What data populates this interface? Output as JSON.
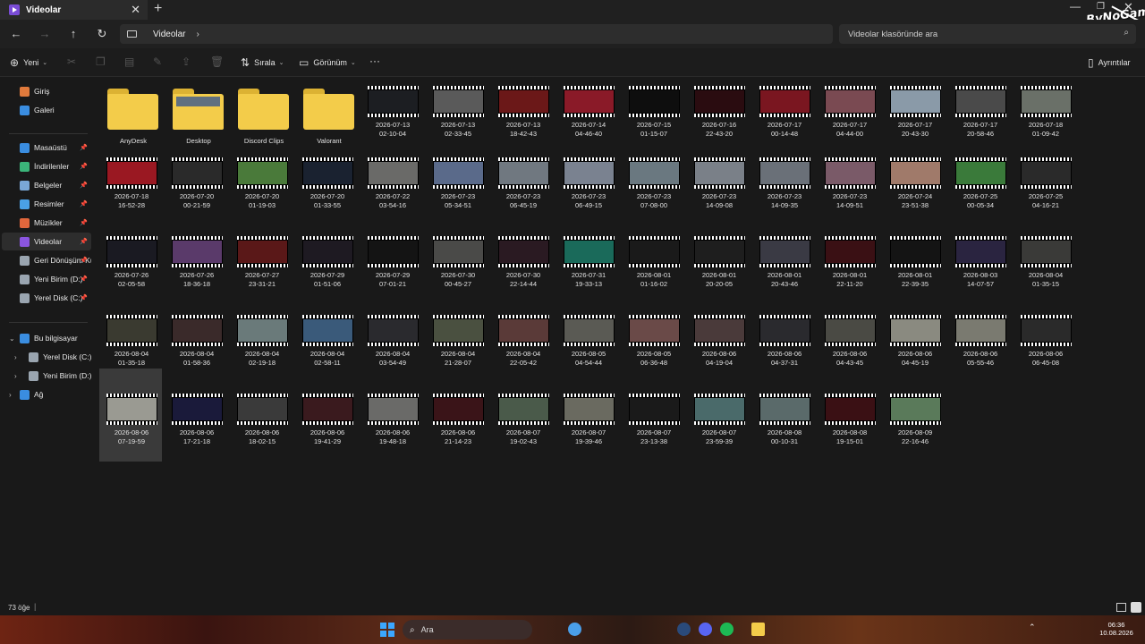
{
  "window": {
    "tab_title": "Videolar",
    "tab_close": "✕",
    "new_tab": "+",
    "brand": "ByNoGame",
    "brand_suffix": ".com"
  },
  "nav": {
    "back": "←",
    "forward": "→",
    "up": "↑",
    "refresh": "↻",
    "location": "Videolar",
    "chevron": "›",
    "search_placeholder": "Videolar klasöründe ara",
    "search_icon": "⌕"
  },
  "commands": {
    "new_label": "Yeni",
    "sort_label": "Sırala",
    "view_label": "Görünüm",
    "more_label": "···",
    "details_label": "Ayrıntılar"
  },
  "sidebar": {
    "items": [
      {
        "label": "Giriş",
        "icon": "home-icon",
        "color": "#e07a3c"
      },
      {
        "label": "Galeri",
        "icon": "gallery-icon",
        "color": "#3a8de0"
      },
      {
        "label": "Masaüstü",
        "icon": "desktop-icon",
        "color": "#3a8de0"
      },
      {
        "label": "İndirilenler",
        "icon": "download-icon",
        "color": "#3bb57a"
      },
      {
        "label": "Belgeler",
        "icon": "documents-icon",
        "color": "#7aa7d6"
      },
      {
        "label": "Resimler",
        "icon": "pictures-icon",
        "color": "#4aa0e6"
      },
      {
        "label": "Müzikler",
        "icon": "music-icon",
        "color": "#e0673c"
      },
      {
        "label": "Videolar",
        "icon": "videos-icon",
        "color": "#8b55e0"
      },
      {
        "label": "Geri Dönüşüm Kutusu",
        "icon": "recycle-bin-icon",
        "color": "#9aa5b0"
      },
      {
        "label": "Yeni Birim (D:)",
        "icon": "drive-icon",
        "color": "#9aa5b0"
      },
      {
        "label": "Yerel Disk (C:)",
        "icon": "drive-icon",
        "color": "#9aa5b0"
      },
      {
        "label": "Bu bilgisayar",
        "icon": "computer-icon",
        "color": "#3a8de0"
      },
      {
        "label": "Yerel Disk (C:)",
        "icon": "drive-icon",
        "color": "#9aa5b0"
      },
      {
        "label": "Yeni Birim (D:)",
        "icon": "drive-icon",
        "color": "#9aa5b0"
      },
      {
        "label": "Ağ",
        "icon": "network-icon",
        "color": "#3a8de0"
      }
    ]
  },
  "folders": [
    {
      "name": "AnyDesk",
      "preview": false
    },
    {
      "name": "Desktop",
      "preview": true
    },
    {
      "name": "Discord Clips",
      "preview": false
    },
    {
      "name": "Valorant",
      "preview": false
    }
  ],
  "videos": [
    {
      "name": "2026-07-13\n02-10-04",
      "thumb": "#1c1e22"
    },
    {
      "name": "2026-07-13\n02-33-45",
      "thumb": "#5a5a5a"
    },
    {
      "name": "2026-07-13\n18-42-43",
      "thumb": "#6b1818"
    },
    {
      "name": "2026-07-14\n04-46-40",
      "thumb": "#8a1a28"
    },
    {
      "name": "2026-07-15\n01-15-07",
      "thumb": "#0e0e0e"
    },
    {
      "name": "2026-07-16\n22-43-20",
      "thumb": "#2a0c10"
    },
    {
      "name": "2026-07-17\n00-14-48",
      "thumb": "#7a1620"
    },
    {
      "name": "2026-07-17\n04-44-00",
      "thumb": "#7a4a52"
    },
    {
      "name": "2026-07-17\n20-43-30",
      "thumb": "#8a9aa8"
    },
    {
      "name": "2026-07-17\n20-58-46",
      "thumb": "#4a4a4a"
    },
    {
      "name": "2026-07-18\n01-09-42",
      "thumb": "#6a7068"
    },
    {
      "name": "2026-07-18\n16-52-28",
      "thumb": "#9a1822"
    },
    {
      "name": "2026-07-20\n00-21-59",
      "thumb": "#2a2a2a"
    },
    {
      "name": "2026-07-20\n01-19-03",
      "thumb": "#4a7a3a"
    },
    {
      "name": "2026-07-20\n01-33-55",
      "thumb": "#1a2230"
    },
    {
      "name": "2026-07-22\n03-54-16",
      "thumb": "#6a6a68"
    },
    {
      "name": "2026-07-23\n05-34-51",
      "thumb": "#5a6a8a"
    },
    {
      "name": "2026-07-23\n06-45-19",
      "thumb": "#707880"
    },
    {
      "name": "2026-07-23\n06-49-15",
      "thumb": "#7a8290"
    },
    {
      "name": "2026-07-23\n07-08-00",
      "thumb": "#6a7880"
    },
    {
      "name": "2026-07-23\n14-09-08",
      "thumb": "#7a8088"
    },
    {
      "name": "2026-07-23\n14-09-35",
      "thumb": "#6a7078"
    },
    {
      "name": "2026-07-23\n14-09-51",
      "thumb": "#7a5a68"
    },
    {
      "name": "2026-07-24\n23-51-38",
      "thumb": "#a07a6a"
    },
    {
      "name": "2026-07-25\n00-05-34",
      "thumb": "#3a7a3a"
    },
    {
      "name": "2026-07-25\n04-16-21",
      "thumb": "#2a2a2a"
    },
    {
      "name": "2026-07-26\n02-05-58",
      "thumb": "#1a1a22"
    },
    {
      "name": "2026-07-26\n18-36-18",
      "thumb": "#5a3a6a"
    },
    {
      "name": "2026-07-27\n23-31-21",
      "thumb": "#5a1818"
    },
    {
      "name": "2026-07-29\n01-51-06",
      "thumb": "#1e1a22"
    },
    {
      "name": "2026-07-29\n07-01-21",
      "thumb": "#141414"
    },
    {
      "name": "2026-07-30\n00-45-27",
      "thumb": "#4a4a48"
    },
    {
      "name": "2026-07-30\n22-14-44",
      "thumb": "#2a1a22"
    },
    {
      "name": "2026-07-31\n19-33-13",
      "thumb": "#1a6a5a"
    },
    {
      "name": "2026-08-01\n01-16-02",
      "thumb": "#1a1a1a"
    },
    {
      "name": "2026-08-01\n20-20-05",
      "thumb": "#1e1e1e"
    },
    {
      "name": "2026-08-01\n20-43-46",
      "thumb": "#3a3a44"
    },
    {
      "name": "2026-08-01\n22-11-20",
      "thumb": "#3a1014"
    },
    {
      "name": "2026-08-01\n22-39-35",
      "thumb": "#141414"
    },
    {
      "name": "2026-08-03\n14-07-57",
      "thumb": "#2a2440"
    },
    {
      "name": "2026-08-04\n01-35-15",
      "thumb": "#3a3a38"
    },
    {
      "name": "2026-08-04\n01-35-18",
      "thumb": "#3a3a30"
    },
    {
      "name": "2026-08-04\n01-58-36",
      "thumb": "#3a2a2a"
    },
    {
      "name": "2026-08-04\n02-19-18",
      "thumb": "#6a7a7a"
    },
    {
      "name": "2026-08-04\n02-58-11",
      "thumb": "#3a5a7a"
    },
    {
      "name": "2026-08-04\n03-54-49",
      "thumb": "#2a2a2e"
    },
    {
      "name": "2026-08-04\n21-28-07",
      "thumb": "#4a5040"
    },
    {
      "name": "2026-08-04\n22-05-42",
      "thumb": "#5a3a38"
    },
    {
      "name": "2026-08-05\n04-54-44",
      "thumb": "#5a5a54"
    },
    {
      "name": "2026-08-05\n06-36-48",
      "thumb": "#6a4a48"
    },
    {
      "name": "2026-08-06\n04-19-04",
      "thumb": "#4a3a3a"
    },
    {
      "name": "2026-08-06\n04-37-31",
      "thumb": "#2a2a2e"
    },
    {
      "name": "2026-08-06\n04-43-45",
      "thumb": "#4a4a44"
    },
    {
      "name": "2026-08-06\n04-45-19",
      "thumb": "#8a8a80"
    },
    {
      "name": "2026-08-06\n05-55-46",
      "thumb": "#7a7a70"
    },
    {
      "name": "2026-08-06\n06-45-08",
      "thumb": "#2a2a2a"
    },
    {
      "name": "2026-08-06\n07-19-59",
      "thumb": "#9a9a92",
      "selected": true
    },
    {
      "name": "2026-08-06\n17-21-18",
      "thumb": "#1a1a3a"
    },
    {
      "name": "2026-08-06\n18-02-15",
      "thumb": "#3a3a3a"
    },
    {
      "name": "2026-08-06\n19-41-29",
      "thumb": "#3a1a1e"
    },
    {
      "name": "2026-08-06\n19-48-18",
      "thumb": "#6a6a68"
    },
    {
      "name": "2026-08-06\n21-14-23",
      "thumb": "#3a1418"
    },
    {
      "name": "2026-08-07\n19-02-43",
      "thumb": "#4a5a4a"
    },
    {
      "name": "2026-08-07\n19-39-46",
      "thumb": "#6a6a60"
    },
    {
      "name": "2026-08-07\n23-13-38",
      "thumb": "#1a1a1a"
    },
    {
      "name": "2026-08-07\n23-59-39",
      "thumb": "#4a6a6a"
    },
    {
      "name": "2026-08-08\n00-10-31",
      "thumb": "#5a6a6a"
    },
    {
      "name": "2026-08-08\n19-15-01",
      "thumb": "#3a1014"
    },
    {
      "name": "2026-08-09\n22-16-46",
      "thumb": "#5a7a5a"
    }
  ],
  "status": {
    "item_count": "73 öğe",
    "separator": "|"
  },
  "taskbar": {
    "search_text": "Ara",
    "search_icon": "⌕",
    "tray_chevron": "⌃",
    "time": "06:36",
    "date": "10.08.2026",
    "apps": [
      {
        "icon": "chrome-icon",
        "color": "#4a9ee8"
      },
      {
        "icon": "steam-icon",
        "color": "#2a4a7a"
      },
      {
        "icon": "discord-icon",
        "color": "#5865f2"
      },
      {
        "icon": "spotify-icon",
        "color": "#1db954"
      },
      {
        "icon": "explorer-icon",
        "color": "#f3cc4a"
      }
    ]
  }
}
